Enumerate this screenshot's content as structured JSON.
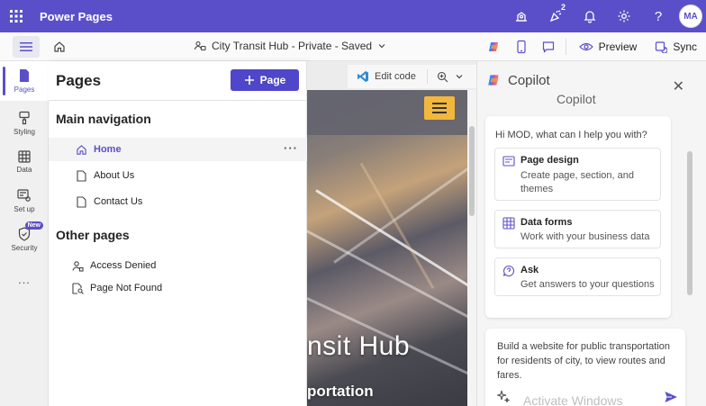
{
  "app": {
    "title": "Power Pages",
    "notification_badge": "2",
    "user_initials": "MA"
  },
  "subbar": {
    "site_name": "City Transit Hub - Private - Saved",
    "preview_label": "Preview",
    "sync_label": "Sync"
  },
  "rail": {
    "items": [
      {
        "label": "Pages"
      },
      {
        "label": "Styling"
      },
      {
        "label": "Data"
      },
      {
        "label": "Set up"
      },
      {
        "label": "Security",
        "badge": "New"
      },
      {
        "label": "..."
      }
    ]
  },
  "pages_panel": {
    "title": "Pages",
    "add_button_label": "Page",
    "main_nav_heading": "Main navigation",
    "main_nav": [
      {
        "label": "Home",
        "selected": true,
        "more": "···"
      },
      {
        "label": "About Us"
      },
      {
        "label": "Contact Us"
      }
    ],
    "other_heading": "Other pages",
    "other_pages": [
      {
        "label": "Access Denied"
      },
      {
        "label": "Page Not Found"
      }
    ]
  },
  "canvas": {
    "edit_code_label": "Edit code",
    "hero_title": "nsit Hub",
    "hero_subtitle": "portation"
  },
  "copilot": {
    "title": "Copilot",
    "ghost_title": "Copilot",
    "greeting": "Hi MOD, what can I help you with?",
    "suggestions": [
      {
        "title": "Page design",
        "desc": "Create page, section, and themes"
      },
      {
        "title": "Data forms",
        "desc": "Work with your business data"
      },
      {
        "title": "Ask",
        "desc": "Get answers to your questions"
      }
    ],
    "input_text": "Build a website for public transportation for residents of city, to view routes and fares.",
    "watermark": "Activate Windows"
  },
  "colors": {
    "brand": "#5b4fc9",
    "button": "#4f46c9",
    "accent_yellow": "#f2b73b"
  }
}
